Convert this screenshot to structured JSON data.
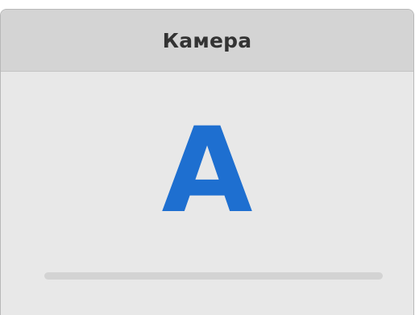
{
  "header": {
    "title": "Камера"
  },
  "camera": {
    "letter": "A",
    "color": "#1e6fd0"
  },
  "progress": {
    "value": 0
  }
}
